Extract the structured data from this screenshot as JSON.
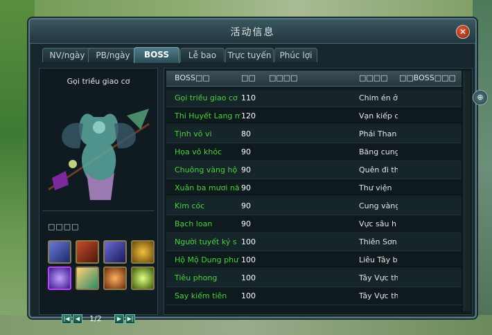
{
  "window": {
    "title": "活动信息",
    "close_label": "✕"
  },
  "tabs": [
    {
      "label": "NV/ngày",
      "active": false
    },
    {
      "label": "PB/ngày",
      "active": false
    },
    {
      "label": "BOSS",
      "active": true
    },
    {
      "label": "Lễ bao",
      "active": false
    },
    {
      "label": "Trực tuyến",
      "active": false
    },
    {
      "label": "Phúc lợi",
      "active": false
    }
  ],
  "left": {
    "boss_name": "Gọi triều giao cơ",
    "rewards_label": "□□□□",
    "items": [
      {
        "icon": "armor-icon",
        "color": "#3a4aa8"
      },
      {
        "icon": "dragon-scroll-icon",
        "color": "#8a2a1a"
      },
      {
        "icon": "beast-icon",
        "color": "#3a3a8a"
      },
      {
        "icon": "gold-coin-icon",
        "color": "#a0701a"
      },
      {
        "icon": "spirit-orb-icon",
        "color": "#5a2aa8"
      },
      {
        "icon": "green-crystal-icon",
        "color": "#2a8a5a"
      },
      {
        "icon": "egg-icon",
        "color": "#a0501a"
      },
      {
        "icon": "green-gem-icon",
        "color": "#6a9a1a"
      }
    ],
    "pager": {
      "text": "1/2",
      "first": "|◀",
      "prev": "◀",
      "next": "▶",
      "last": "▶|"
    }
  },
  "table": {
    "headers": [
      "BOSS□□",
      "□□",
      "□□□□",
      "□□□□",
      "□□BOSS□□□"
    ],
    "rows": [
      {
        "name": "Gọi triều giao cơ",
        "level": "110",
        "location": "Chim én ở",
        "time": ""
      },
      {
        "name": "Thi Huyết Lang m",
        "level": "120",
        "location": "Vạn kiếp c",
        "time": ""
      },
      {
        "name": "Tịnh vô vi",
        "level": "80",
        "location": "Phái Than",
        "time": ""
      },
      {
        "name": "Họa vô khóc",
        "level": "90",
        "location": "Băng cung",
        "time": ""
      },
      {
        "name": "Chuông vàng hộ",
        "level": "90",
        "location": "Quên đi th",
        "time": ""
      },
      {
        "name": "Xuân ba mươi nă",
        "level": "90",
        "location": "Thư viện",
        "time": ""
      },
      {
        "name": "Kim cóc",
        "level": "90",
        "location": "Cung vàng",
        "time": ""
      },
      {
        "name": "Bạch loan",
        "level": "90",
        "location": "Vực sâu h",
        "time": ""
      },
      {
        "name": "Người tuyết ký s",
        "level": "100",
        "location": "Thiên Sơn",
        "time": ""
      },
      {
        "name": "Hộ Mộ Dung phư",
        "level": "100",
        "location": "Liêu Tây b",
        "time": ""
      },
      {
        "name": "Tiêu phong",
        "level": "100",
        "location": "Tây Vực th",
        "time": ""
      },
      {
        "name": "Say kiếm tiên",
        "level": "100",
        "location": "Tây Vực th",
        "time": ""
      }
    ]
  },
  "side": {
    "locate_label": "⊕"
  }
}
